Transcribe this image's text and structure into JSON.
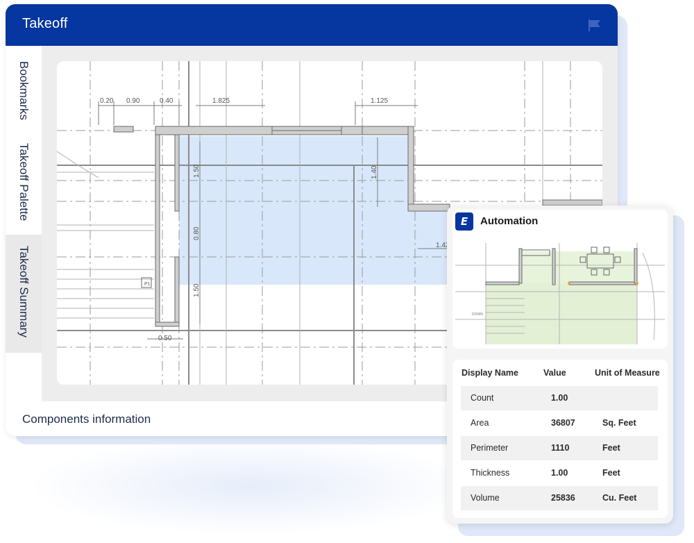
{
  "window": {
    "title": "Takeoff"
  },
  "sidebar": {
    "tabs": [
      {
        "label": "Bookmarks"
      },
      {
        "label": "Takeoff Palette"
      },
      {
        "label": "Takeoff Summary",
        "active": true
      }
    ]
  },
  "drawing": {
    "dimensions": [
      "0.20",
      "0.90",
      "0.40",
      "1.825",
      "1.125",
      "1.50",
      "0.80",
      "1.50",
      "1.40",
      "0.50",
      "1.42"
    ],
    "highlight_color": "#d8e8fa"
  },
  "footer": {
    "components_label": "Components information"
  },
  "automation": {
    "logo": "E",
    "title": "Automation",
    "preview_labels": [
      "DOWN"
    ],
    "table": {
      "headers": [
        "Display Name",
        "Value",
        "Unit of Measure"
      ],
      "rows": [
        {
          "name": "Count",
          "value": "1.00",
          "unit": ""
        },
        {
          "name": "Area",
          "value": "36807",
          "unit": "Sq. Feet"
        },
        {
          "name": "Perimeter",
          "value": "1110",
          "unit": "Feet"
        },
        {
          "name": "Thickness",
          "value": "1.00",
          "unit": "Feet"
        },
        {
          "name": "Volume",
          "value": "25836",
          "unit": "Cu. Feet"
        }
      ]
    }
  },
  "colors": {
    "brand_blue": "#0636a0",
    "preview_green": "#e3f0d6",
    "marker_orange": "#f0a030"
  },
  "icons": {
    "titlebar_right": "flag-icon",
    "panel_logo": "logo-icon"
  }
}
